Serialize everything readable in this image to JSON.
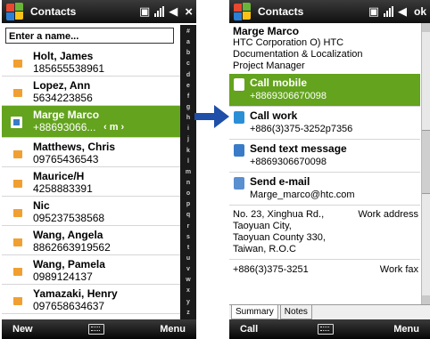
{
  "left": {
    "title": "Contacts",
    "search_placeholder": "Enter a name...",
    "alphabet": [
      "#",
      "a",
      "b",
      "c",
      "d",
      "e",
      "f",
      "g",
      "h",
      "i",
      "j",
      "k",
      "l",
      "m",
      "n",
      "o",
      "p",
      "q",
      "r",
      "s",
      "t",
      "u",
      "v",
      "w",
      "x",
      "y",
      "z"
    ],
    "contacts": [
      {
        "name": "Holt, James",
        "detail": "185655538961"
      },
      {
        "name": "Lopez, Ann",
        "detail": "5634223856"
      },
      {
        "name": "Marge Marco",
        "detail": "+88693066...",
        "hint": "‹  m ›",
        "selected": true
      },
      {
        "name": "Matthews, Chris",
        "detail": "09765436543"
      },
      {
        "name": "Maurice/H",
        "detail": "4258883391"
      },
      {
        "name": "Nic",
        "detail": "095237538568"
      },
      {
        "name": "Wang, Angela",
        "detail": "8862663919562"
      },
      {
        "name": "Wang, Pamela",
        "detail": "0989124137"
      },
      {
        "name": "Yamazaki, Henry",
        "detail": "097658634637"
      }
    ],
    "soft_left": "New",
    "soft_right": "Menu",
    "close_label": "×"
  },
  "right": {
    "title": "Contacts",
    "ok_label": "ok",
    "name": "Marge Marco",
    "company": "HTC Corporation O) HTC",
    "department": "Documentation & Localization",
    "job_title": "Project Manager",
    "actions": [
      {
        "title": "Call mobile",
        "value": "+8869306670098",
        "selected": true
      },
      {
        "title": "Call work",
        "value": "+886(3)375-3252p7356"
      },
      {
        "title": "Send text message",
        "value": "+8869306670098"
      },
      {
        "title": "Send e-mail",
        "value": "Marge_marco@htc.com"
      }
    ],
    "address_lines": [
      "No. 23, Xinghua Rd.,",
      "Taoyuan City,",
      "Taoyuan County 330,",
      "Taiwan, R.O.C"
    ],
    "address_label": "Work address",
    "fax_value": "+886(3)375-3251",
    "fax_label": "Work fax",
    "tabs": [
      "Summary",
      "Notes"
    ],
    "soft_left": "Call",
    "soft_right": "Menu"
  },
  "colors": {
    "selection": "#63a31d",
    "bar": "#101010",
    "arrow": "#1f4fa8"
  }
}
